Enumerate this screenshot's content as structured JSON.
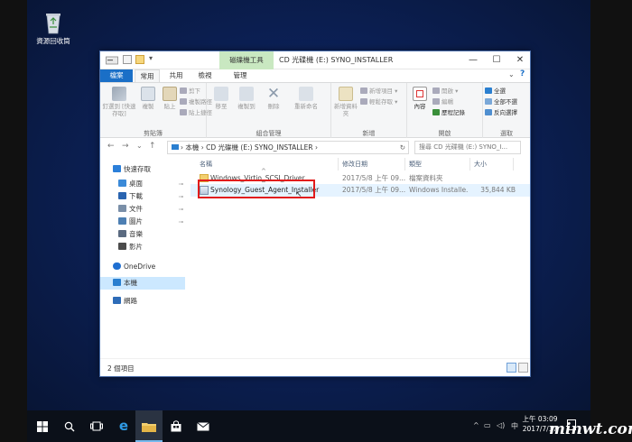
{
  "desktop": {
    "recycle_bin_label": "資源回收筒"
  },
  "window": {
    "context_tab": "磁碟機工具",
    "title": "CD 光碟機 (E:) SYNO_INSTALLER",
    "minimize": "—",
    "maximize": "☐",
    "close": "✕"
  },
  "tabs": {
    "file": "檔案",
    "home": "常用",
    "share": "共用",
    "view": "檢視",
    "manage": "管理"
  },
  "ribbon": {
    "clipboard": {
      "label": "剪貼簿",
      "pin": "釘選到 [快速存取]",
      "copy": "複製",
      "paste": "貼上",
      "cut": "剪下",
      "copy_path": "複製路徑",
      "paste_shortcut": "貼上捷徑"
    },
    "organize": {
      "label": "組合管理",
      "move_to": "移至",
      "copy_to": "複製到",
      "delete": "刪除",
      "rename": "重新命名"
    },
    "new": {
      "label": "新增",
      "new_folder": "新增資料夾",
      "new_item": "新增項目",
      "easy_access": "輕鬆存取"
    },
    "open": {
      "label": "開啟",
      "properties": "內容",
      "open": "開啟",
      "edit": "編輯",
      "history": "歷程記錄"
    },
    "select": {
      "label": "選取",
      "select_all": "全選",
      "select_none": "全部不選",
      "invert": "反向選擇"
    }
  },
  "address": {
    "back": "←",
    "forward": "→",
    "dropdown": "⌄",
    "up": "↑",
    "path": "› 本機 › CD 光碟機 (E:) SYNO_INSTALLER ›",
    "search_placeholder": "搜尋 CD 光碟機 (E:) SYNO_I...",
    "refresh": "↻"
  },
  "navpane": {
    "items": [
      {
        "label": "快速存取",
        "icon": "star-icon",
        "color": "#2b7fd9"
      },
      {
        "label": "桌面",
        "icon": "desktop-icon",
        "color": "#3b8ad8",
        "pinned": true
      },
      {
        "label": "下載",
        "icon": "download-icon",
        "color": "#2a64b0",
        "pinned": true
      },
      {
        "label": "文件",
        "icon": "document-icon",
        "color": "#7a8fa8",
        "pinned": true
      },
      {
        "label": "圖片",
        "icon": "picture-icon",
        "color": "#4d7fb3",
        "pinned": true
      },
      {
        "label": "音樂",
        "icon": "music-icon",
        "color": "#5a6a80"
      },
      {
        "label": "影片",
        "icon": "video-icon",
        "color": "#4b4b4b"
      },
      {
        "label": "OneDrive",
        "icon": "cloud-icon",
        "color": "#1f6fd1"
      },
      {
        "label": "本機",
        "icon": "computer-icon",
        "color": "#2a7fd0"
      },
      {
        "label": "網路",
        "icon": "network-icon",
        "color": "#2e6cb8"
      }
    ],
    "pin_glyph": "📌"
  },
  "columns": {
    "name": "名稱",
    "modified": "修改日期",
    "type": "類型",
    "size": "大小"
  },
  "files": [
    {
      "name": "Windows_Virtio_SCSI_Driver",
      "modified": "2017/5/8 上午 09...",
      "type": "檔案資料夾",
      "size": "",
      "icon": "folder-icon"
    },
    {
      "name": "Synology_Guest_Agent_Installer",
      "modified": "2017/5/8 上午 09...",
      "type": "Windows Installe...",
      "size": "35,844 KB",
      "icon": "installer-icon"
    }
  ],
  "status": {
    "count": "2 個項目"
  },
  "taskbar": {
    "clock_time": "上午 03:09",
    "clock_date": "2017/7/17",
    "tray_ime": "中"
  },
  "watermark": "minwt.com",
  "colors": {
    "accent": "#1a6fc7",
    "context_tab": "#c9e8c1",
    "highlight_box": "#e21b1b",
    "selection": "#cce8ff"
  }
}
